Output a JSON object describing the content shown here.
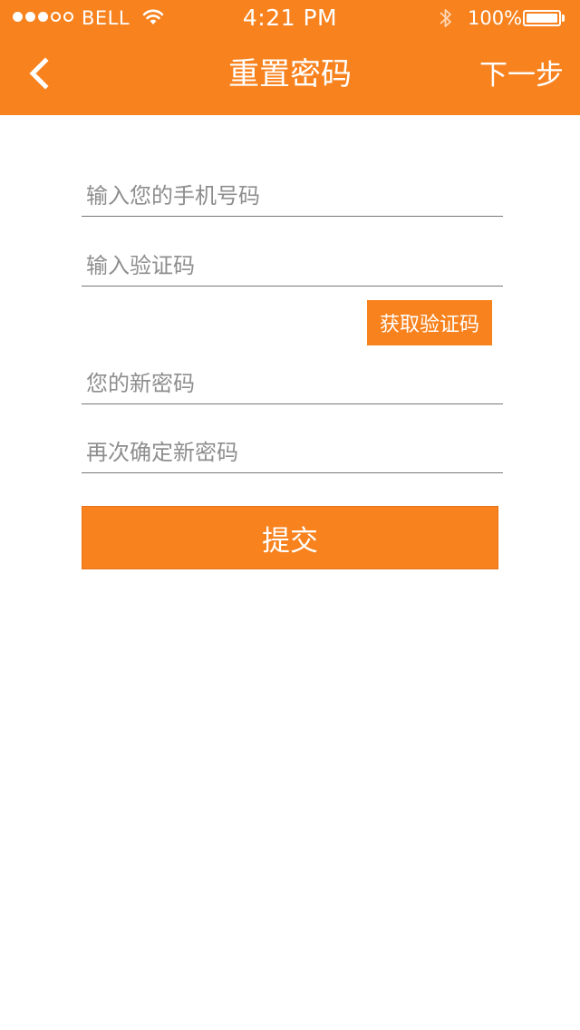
{
  "status_bar": {
    "carrier": "BELL",
    "time": "4:21 PM",
    "battery": "100%",
    "signal_bars_filled": 3,
    "signal_bars_total": 5,
    "battery_level": 1.0
  },
  "nav": {
    "title": "重置密码",
    "next_label": "下一步",
    "back_icon": "chevron-left-icon"
  },
  "form": {
    "phone_placeholder": "输入您的手机号码",
    "phone_value": "",
    "code_placeholder": "输入验证码",
    "code_value": "",
    "get_code_label": "获取验证码",
    "new_password_placeholder": "您的新密码",
    "new_password_value": "",
    "confirm_password_placeholder": "再次确定新密码",
    "confirm_password_value": "",
    "submit_label": "提交"
  },
  "colors": {
    "accent": "#f7821e",
    "background": "#ffffff",
    "placeholder": "#8e8e8e",
    "divider": "#777777"
  }
}
